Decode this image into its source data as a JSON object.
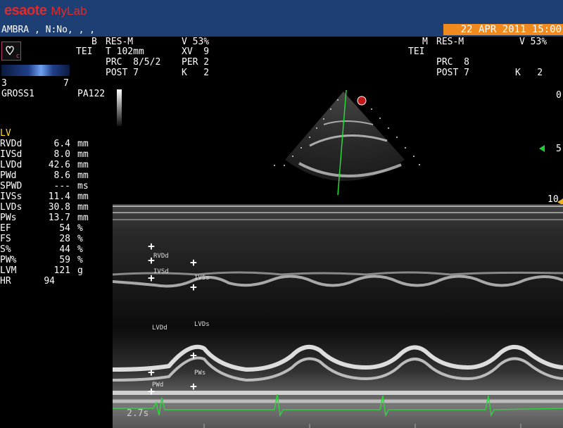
{
  "header": {
    "brand": "esaote",
    "product": "MyLab",
    "patient": "AMBRA , N:No, , ,",
    "datetime": "22 APR 2011 15:00"
  },
  "b_params": {
    "mode": "B",
    "preset": "RES-M",
    "v": "V 53%",
    "tei": "TEI",
    "t": "T 102mm",
    "xv": "XV  9",
    "prc": "PRC  8/5/2",
    "per": "PER 2",
    "post": "POST 7",
    "k": "K   2"
  },
  "m_params": {
    "mode": "M",
    "preset": "RES-M",
    "v": "V 53%",
    "tei": "TEI",
    "prc": "PRC  8",
    "post": "POST 7",
    "k": "K   2"
  },
  "side": {
    "scale_low": "3",
    "scale_high": "7",
    "label1": "GROSS1",
    "probe": "PA122"
  },
  "measurements": {
    "title": "LV",
    "rows": [
      {
        "name": "RVDd",
        "value": "6.4",
        "unit": "mm"
      },
      {
        "name": "IVSd",
        "value": "8.0",
        "unit": "mm"
      },
      {
        "name": "LVDd",
        "value": "42.6",
        "unit": "mm"
      },
      {
        "name": "PWd",
        "value": "8.6",
        "unit": "mm"
      },
      {
        "name": "SPWD",
        "value": "---",
        "unit": "ms"
      },
      {
        "name": "IVSs",
        "value": "11.4",
        "unit": "mm"
      },
      {
        "name": "LVDs",
        "value": "30.8",
        "unit": "mm"
      },
      {
        "name": "PWs",
        "value": "13.7",
        "unit": "mm"
      },
      {
        "name": "EF",
        "value": "54",
        "unit": "%"
      },
      {
        "name": "FS",
        "value": "28",
        "unit": "%"
      },
      {
        "name": "S%",
        "value": "44",
        "unit": "%"
      },
      {
        "name": "PW%",
        "value": "59",
        "unit": "%"
      },
      {
        "name": "LVM",
        "value": "121",
        "unit": "g"
      },
      {
        "name": "HR",
        "value": "94",
        "unit": ""
      }
    ]
  },
  "depth_marks": [
    "0",
    "5",
    "10"
  ],
  "calipers": {
    "rvdd": "RVDd",
    "ivsd": "IVSd",
    "ivss": "IVSs",
    "lvdd": "LVDd",
    "lvds": "LVDs",
    "pws": "PWs",
    "pwd": "PWd"
  },
  "sweep_speed": "2.7s",
  "colors": {
    "header_bg": "#1e3f73",
    "date_bg": "#f08a1e",
    "brand": "#e12a2a",
    "lv_title": "#ffdc28",
    "ecg": "#2fd23c",
    "scanline": "#22dd33"
  }
}
